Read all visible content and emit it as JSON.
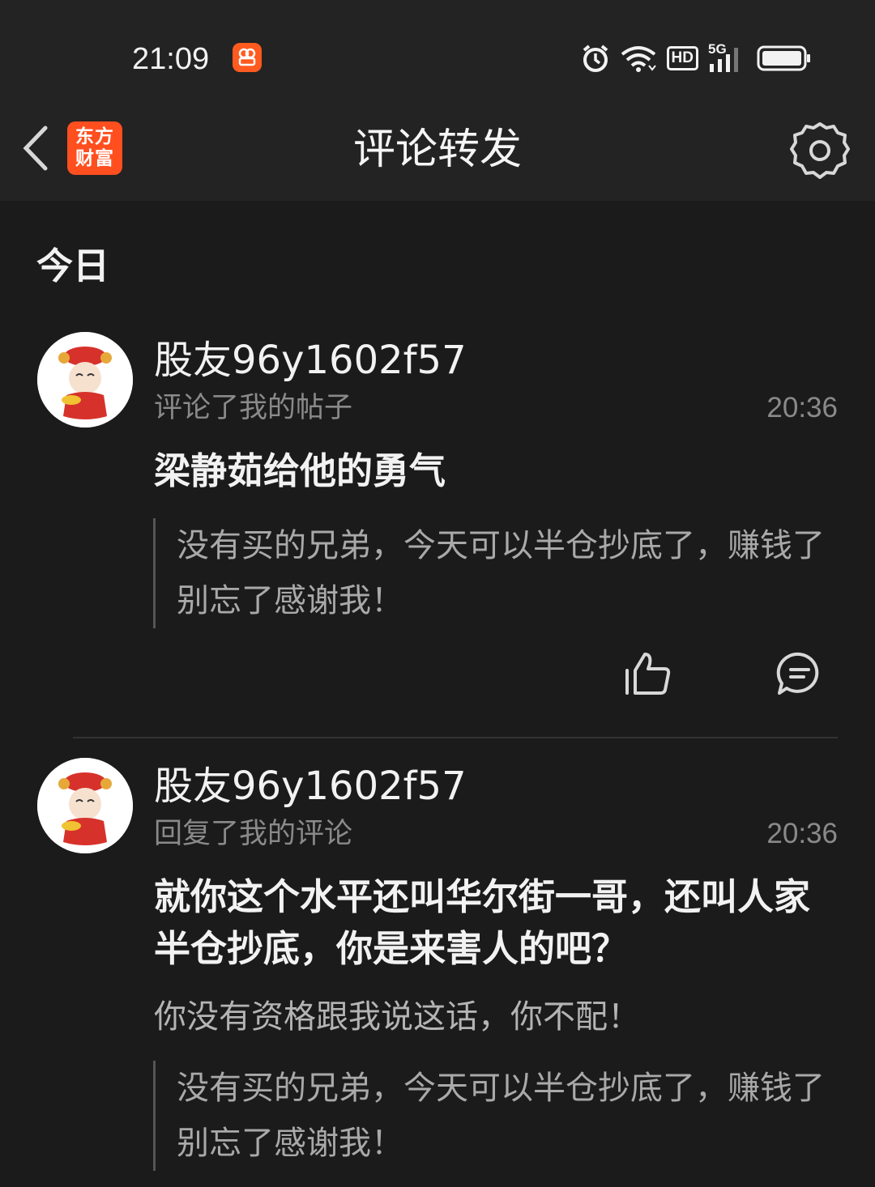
{
  "status_bar": {
    "time": "21:09",
    "icons": [
      "app-notification-icon",
      "alarm-icon",
      "wifi-icon",
      "hd-icon",
      "signal-5g-icon",
      "battery-icon"
    ],
    "hd_label": "HD",
    "network_label": "5G"
  },
  "header": {
    "title": "评论转发",
    "brand_line1": "东方",
    "brand_line2": "财富",
    "brand_color": "#ff4f1f"
  },
  "section": {
    "title": "今日"
  },
  "notifications": [
    {
      "username": "股友96y1602f57",
      "action": "评论了我的帖子",
      "time": "20:36",
      "comment": "梁静茹给他的勇气",
      "quote": "没有买的兄弟，今天可以半仓抄底了，赚钱了别忘了感谢我！"
    },
    {
      "username": "股友96y1602f57",
      "action": "回复了我的评论",
      "time": "20:36",
      "comment": "就你这个水平还叫华尔街一哥，还叫人家半仓抄底，你是来害人的吧？",
      "reply": "你没有资格跟我说这话，你不配！",
      "quote": "没有买的兄弟，今天可以半仓抄底了，赚钱了别忘了感谢我！"
    }
  ]
}
